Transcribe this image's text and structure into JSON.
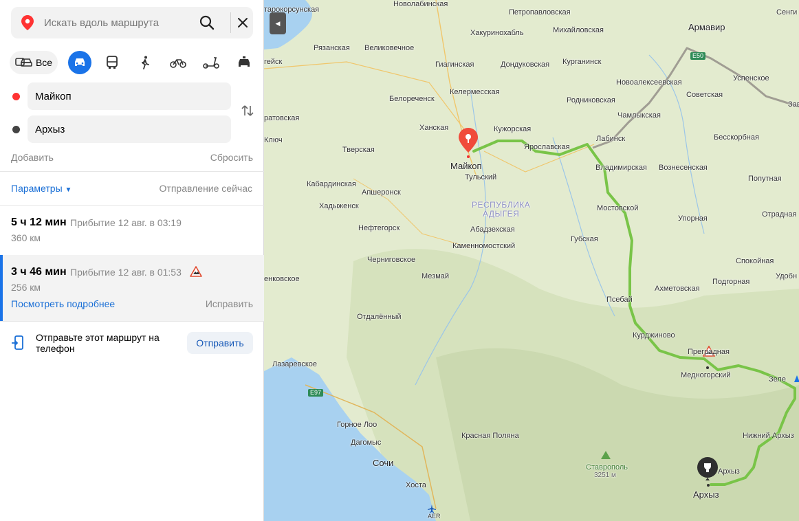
{
  "search": {
    "placeholder": "Искать вдоль маршрута"
  },
  "modes": {
    "all_label": "Все"
  },
  "points": {
    "from": "Майкоп",
    "to": "Архыз"
  },
  "actions": {
    "add": "Добавить",
    "reset": "Сбросить"
  },
  "params": {
    "label": "Параметры",
    "departure": "Отправление сейчас"
  },
  "routes": [
    {
      "time": "5 ч 12 мин",
      "arrival": "Прибытие 12 авг. в 03:19",
      "distance": "360 км"
    },
    {
      "time": "3 ч 46 мин",
      "arrival": "Прибытие 12 авг. в 01:53",
      "distance": "256 км",
      "details": "Посмотреть подробнее",
      "fix": "Исправить"
    }
  ],
  "send": {
    "text": "Отправьте этот маршрут на телефон",
    "button": "Отправить"
  },
  "map": {
    "labels": {
      "starokorsunskaya": "тарокорсунская",
      "novolabinskaya": "Новолабинская",
      "petropavlovskaya": "Петропавловская",
      "armavir": "Армавир",
      "sengi": "Сенги",
      "khakurinokhabl": "Хакуринохабль",
      "mikhaylovskaya": "Михайловская",
      "ryazanskaya": "Рязанская",
      "velikovechnoe": "Великовечное",
      "geysk": "гейск",
      "giaginskaya": "Гиагинская",
      "dondukovskaya": "Дондуковская",
      "kurganinsk": "Курганинск",
      "uspenskoe": "Успенское",
      "novoalekseevskaya": "Новоалексеевская",
      "sovetskaya": "Советская",
      "kelermesskaya": "Келермесская",
      "belorechensk": "Белореченск",
      "rodnikovskaya": "Родниковская",
      "zave": "Заве",
      "chamlykskaya": "Чамлыкская",
      "bratovskaya": "ратовская",
      "khanskaya": "Ханская",
      "kuzhorskaya": "Кужорская",
      "labinsk": "Лабинск",
      "besskorbnaya": "Бесскорбная",
      "klyuch": "Ключ",
      "tverskaya": "Тверская",
      "yaroslavskaya": "Ярославская",
      "maykop": "Майкоп",
      "vladimirskaya": "Владимирская",
      "voznesenskaya": "Вознесенская",
      "tulsky": "Тульский",
      "popytnaya": "Попутная",
      "kabardinskaya": "Кабардинская",
      "apsheronsk": "Апшеронск",
      "region": "РЕСПУБЛИКА\nАДЫГЕЯ",
      "khadyzhensk": "Хадыженск",
      "mostovskoy": "Мостовской",
      "otradnaya": "Отрадная",
      "neftegorsk": "Нефтегорск",
      "abadzekhskaya": "Абадзехская",
      "ulornaya": "Упорная",
      "gubskaya": "Губская",
      "kamennomostsky": "Каменномостский",
      "chernigovskoe": "Черниговское",
      "sokolnaya": "Спокойная",
      "udobny": "Удобн",
      "venkovskoe": "енковское",
      "mezmay": "Мезмай",
      "podgornaya": "Подгорная",
      "akhmetovskaya": "Ахметовская",
      "psebay": "Псебай",
      "otdalenny": "Отдалённый",
      "kurdzhinovo": "Курджиново",
      "pregradnaya": "Преградная",
      "lazarevskoe": "Лазаревское",
      "mednogorsky": "Медногорский",
      "zele": "Зеле",
      "gornoe_loo": "Горное Лоо",
      "dagomys": "Дагомыс",
      "krasnaya_polyana": "Красная Поляна",
      "nizhny_arkhyz": "Нижний Архыз",
      "stavropol": "Ставрополь",
      "stavropol_h": "3251 м",
      "sochi": "Сочи",
      "arkhyz_small": "Архыз",
      "arkhyz": "Архыз",
      "khosta": "Хоста",
      "aer": "AER",
      "e97": "E97",
      "e50": "E50"
    }
  }
}
